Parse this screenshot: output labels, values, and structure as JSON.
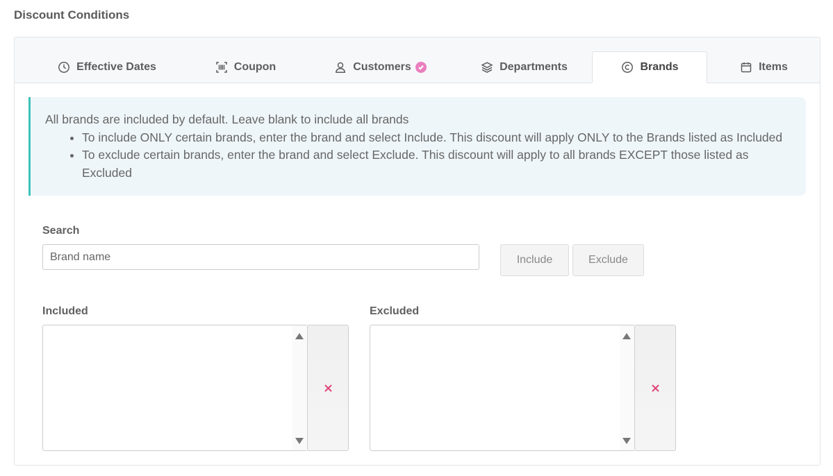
{
  "section_title": "Discount Conditions",
  "tabs": [
    {
      "label": "Effective Dates",
      "icon": "clock-icon"
    },
    {
      "label": "Coupon",
      "icon": "barcode-icon"
    },
    {
      "label": "Customers",
      "icon": "user-icon",
      "badge": "check-badge"
    },
    {
      "label": "Departments",
      "icon": "layers-icon"
    },
    {
      "label": "Brands",
      "icon": "copyright-icon",
      "active": true
    },
    {
      "label": "Items",
      "icon": "calendar-icon"
    }
  ],
  "info": {
    "intro": "All brands are included by default.  Leave blank to include all brands",
    "bullets": [
      "To include ONLY certain brands, enter the brand and select Include. This discount will apply ONLY to the Brands listed as Included",
      "To exclude certain brands, enter the brand and select Exclude. This discount will apply to all brands EXCEPT those listed as Excluded"
    ]
  },
  "search": {
    "label": "Search",
    "placeholder": "Brand name",
    "value": ""
  },
  "buttons": {
    "include": "Include",
    "exclude": "Exclude"
  },
  "lists": {
    "included_label": "Included",
    "excluded_label": "Excluded"
  },
  "colors": {
    "accent": "#3cc3b8",
    "badge": "#e97fbf",
    "clear": "#e0457b"
  }
}
